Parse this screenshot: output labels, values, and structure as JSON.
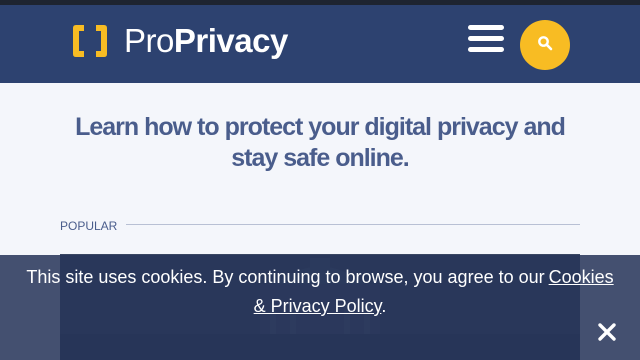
{
  "header": {
    "brand_regular": "Pro",
    "brand_bold": "Privacy",
    "logo_icon": "brackets-logo-icon",
    "menu_icon": "hamburger-menu-icon",
    "search_icon": "search-icon"
  },
  "main": {
    "headline": "Learn how to protect your digital privacy and stay safe online.",
    "section_label": "POPULAR"
  },
  "cookie_banner": {
    "text": "This site uses cookies. By continuing to browse, you agree to our",
    "link_text": "Cookies & Privacy Policy",
    "suffix": ".",
    "close_icon": "close-icon"
  },
  "colors": {
    "header_bg": "#2d4270",
    "accent_yellow": "#f8bc23",
    "headline_text": "#4a5d8c",
    "page_bg": "#f4f6fb",
    "cookie_bg": "#263458"
  }
}
